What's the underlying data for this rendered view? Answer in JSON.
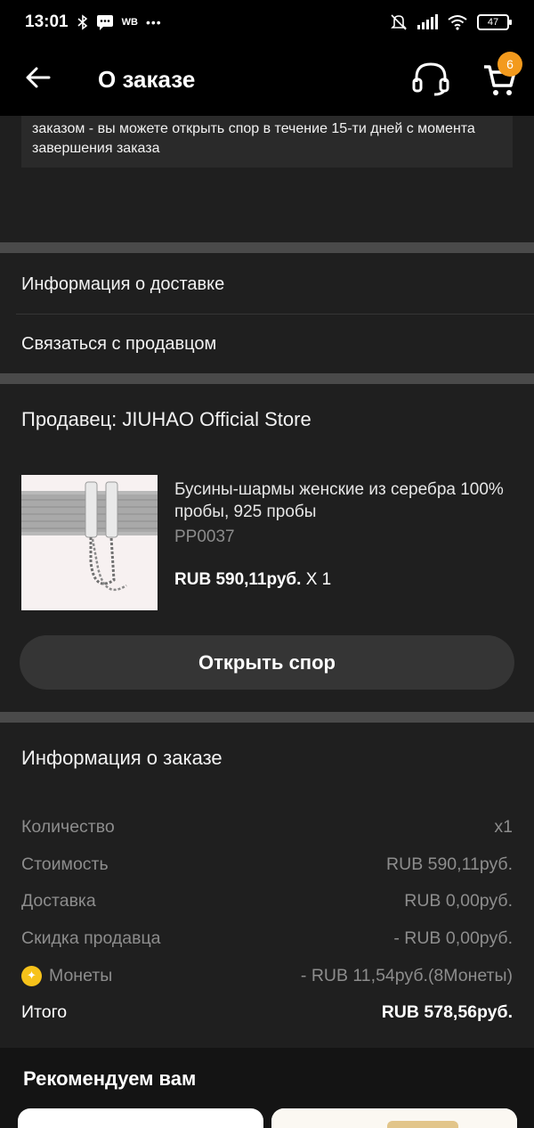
{
  "status_bar": {
    "time": "13:01",
    "carrier_label": "WB",
    "more_dots": "•••",
    "battery": "47"
  },
  "header": {
    "title": "О заказе",
    "cart_count": "6"
  },
  "notice": {
    "text": "заказом - вы можете открыть спор в течение 15-ти дней с момента завершения заказа"
  },
  "links": {
    "delivery_info": "Информация о доставке",
    "contact_seller": "Связаться с продавцом"
  },
  "seller": {
    "label": "Продавец: JIUHAO Official Store"
  },
  "product": {
    "title": "Бусины-шармы женские из серебра 100% пробы, 925 пробы",
    "sku": "PP0037",
    "price": "RUB 590,11руб.",
    "quantity": "X 1"
  },
  "actions": {
    "open_dispute": "Открыть спор"
  },
  "order_info": {
    "title": "Информация о заказе",
    "rows": [
      {
        "label": "Количество",
        "value": "x1"
      },
      {
        "label": "Стоимость",
        "value": "RUB 590,11руб."
      },
      {
        "label": "Доставка",
        "value": "RUB 0,00руб."
      },
      {
        "label": "Скидка продавца",
        "value": "- RUB 0,00руб."
      },
      {
        "label": "Монеты",
        "value": "- RUB 11,54руб.(8Монеты)"
      }
    ],
    "total": {
      "label": "Итого",
      "value": "RUB 578,56руб."
    }
  },
  "recommend": {
    "title": "Рекомендуем вам"
  },
  "colors": {
    "background": "#1f1f1f",
    "header_bg": "#000000",
    "divider": "#4a4a4a",
    "badge": "#f39a1d",
    "coin": "#f6c21a",
    "muted_text": "#8d8d8d"
  }
}
